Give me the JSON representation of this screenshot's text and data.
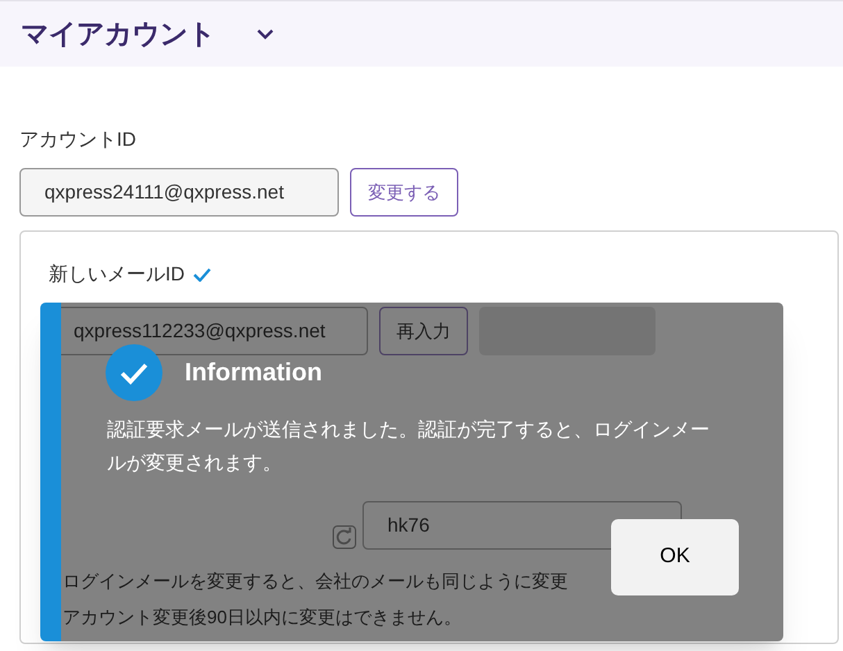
{
  "header": {
    "title": "マイアカウント"
  },
  "account_id": {
    "label": "アカウントID",
    "value": "qxpress24111@qxpress.net",
    "button": "変更する"
  },
  "new_email": {
    "label": "新しいメールID",
    "verified": true,
    "value": "qxpress112233@qxpress.net",
    "retry_button": "再入力",
    "captcha_value": "hk76",
    "notes": [
      "ログインメールを変更すると、会社のメールも同じように変更",
      "アカウント変更後90日以内に変更はできません。"
    ]
  },
  "dialog": {
    "title": "Information",
    "message": "認証要求メールが送信されました。認証が完了すると、ログインメールが変更されます。",
    "button": "OK"
  }
}
